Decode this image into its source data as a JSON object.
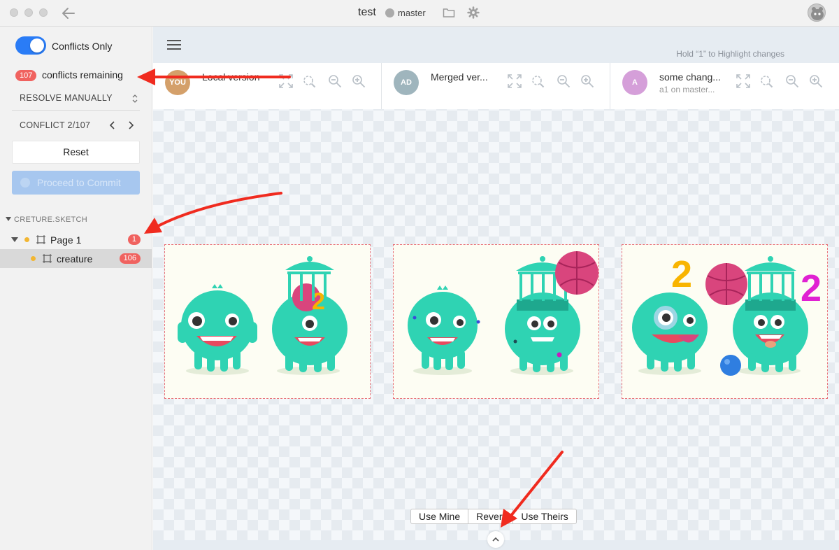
{
  "window": {
    "title": "test",
    "branch": "master"
  },
  "sidebar": {
    "toggle_label": "Conflicts Only",
    "toggle_on": true,
    "conflict_count": "107",
    "conflict_text": "conflicts remaining",
    "resolve_mode": "RESOLVE MANUALLY",
    "conflict_nav": "CONFLICT 2/107",
    "reset_label": "Reset",
    "proceed_label": "Proceed to Commit",
    "tree": {
      "root": "CRETURE.SKETCH",
      "items": [
        {
          "label": "Page 1",
          "badge": "1"
        },
        {
          "label": "creature",
          "badge": "106"
        }
      ]
    }
  },
  "main": {
    "hint": "Hold “1” to Highlight changes",
    "panes": [
      {
        "initials": "YOU",
        "title": "Local version",
        "subtitle": "",
        "avatar_color": "#d4a06a"
      },
      {
        "initials": "AD",
        "title": "Merged ver...",
        "subtitle": "",
        "avatar_color": "#9fb5bd"
      },
      {
        "initials": "A",
        "title": "some chang...",
        "subtitle": "a1 on master...",
        "avatar_color": "#d59fd9"
      }
    ],
    "actions": [
      "Use Mine",
      "Revert",
      "Use Theirs"
    ]
  },
  "colors": {
    "accent": "#2a7cf6",
    "badge": "#f0625f",
    "creature": "#2fd3b3",
    "annotation": "#f02b1f"
  }
}
